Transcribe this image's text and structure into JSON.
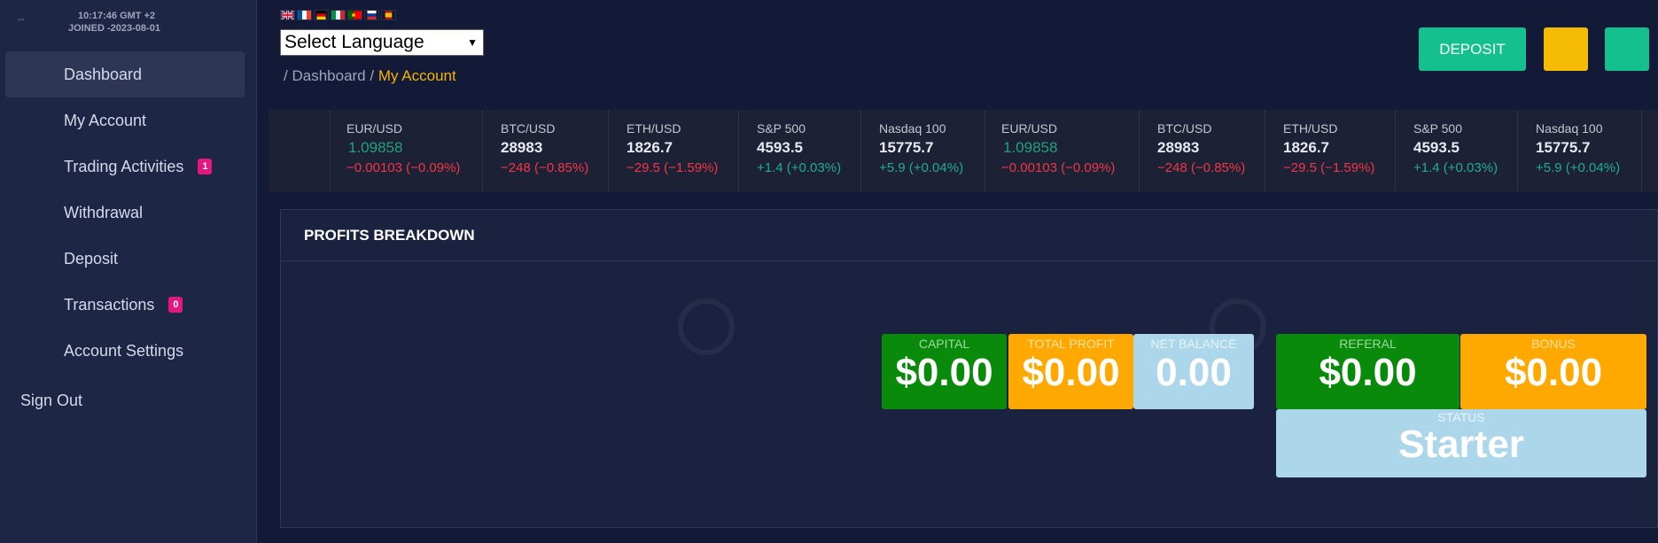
{
  "sidebar": {
    "dash": "--",
    "time": "10:17:46 GMT +2",
    "joined": "JOINED -2023-08-01",
    "items": [
      {
        "label": "Dashboard",
        "active": true
      },
      {
        "label": "My Account"
      },
      {
        "label": "Trading Activities",
        "badge": "1"
      },
      {
        "label": "Withdrawal"
      },
      {
        "label": "Deposit"
      },
      {
        "label": "Transactions",
        "badge": "0"
      },
      {
        "label": "Account Settings"
      }
    ],
    "sign_out": "Sign Out"
  },
  "header": {
    "flags": [
      "uk-flag",
      "fr-flag",
      "de-flag",
      "it-flag",
      "pt-flag",
      "ru-flag",
      "es-flag"
    ],
    "language_select": "Select Language",
    "breadcrumb": {
      "sep1": "/",
      "parent": "Dashboard",
      "sep2": "/",
      "current": "My Account"
    },
    "deposit_label": "DEPOSIT"
  },
  "ticker": [
    {
      "sym": "EUR/USD",
      "price": "1.09858",
      "change": "−0.00103 (−0.09%)",
      "dir": "neg"
    },
    {
      "sym": "BTC/USD",
      "price": "28983",
      "change": "−248 (−0.85%)",
      "dir": "neg"
    },
    {
      "sym": "ETH/USD",
      "price": "1826.7",
      "change": "−29.5 (−1.59%)",
      "dir": "neg"
    },
    {
      "sym": "S&P 500",
      "price": "4593.5",
      "change": "+1.4 (+0.03%)",
      "dir": "pos"
    },
    {
      "sym": "Nasdaq 100",
      "price": "15775.7",
      "change": "+5.9 (+0.04%)",
      "dir": "pos"
    },
    {
      "sym": "EUR/USD",
      "price": "1.09858",
      "change": "−0.00103 (−0.09%)",
      "dir": "neg"
    },
    {
      "sym": "BTC/USD",
      "price": "28983",
      "change": "−248 (−0.85%)",
      "dir": "neg"
    },
    {
      "sym": "ETH/USD",
      "price": "1826.7",
      "change": "−29.5 (−1.59%)",
      "dir": "neg"
    },
    {
      "sym": "S&P 500",
      "price": "4593.5",
      "change": "+1.4 (+0.03%)",
      "dir": "pos"
    },
    {
      "sym": "Nasdaq 100",
      "price": "15775.7",
      "change": "+5.9 (+0.04%)",
      "dir": "pos"
    }
  ],
  "profits": {
    "title": "PROFITS BREAKDOWN",
    "capital": {
      "label": "CAPITAL",
      "value": "$0.00"
    },
    "total_profit": {
      "label": "TOTAL PROFIT",
      "value": "$0.00"
    },
    "net_balance": {
      "label": "NET BALANCE",
      "value": "0.00"
    },
    "referal": {
      "label": "REFERAL",
      "value": "$0.00"
    },
    "bonus": {
      "label": "BONUS",
      "value": "$0.00"
    },
    "status": {
      "label": "STATUS",
      "value": "Starter"
    }
  },
  "colors": {
    "accent_green": "#13c08e",
    "accent_yellow": "#f6bc05",
    "breadcrumb_active": "#f4b400",
    "badge": "#e5177e"
  }
}
